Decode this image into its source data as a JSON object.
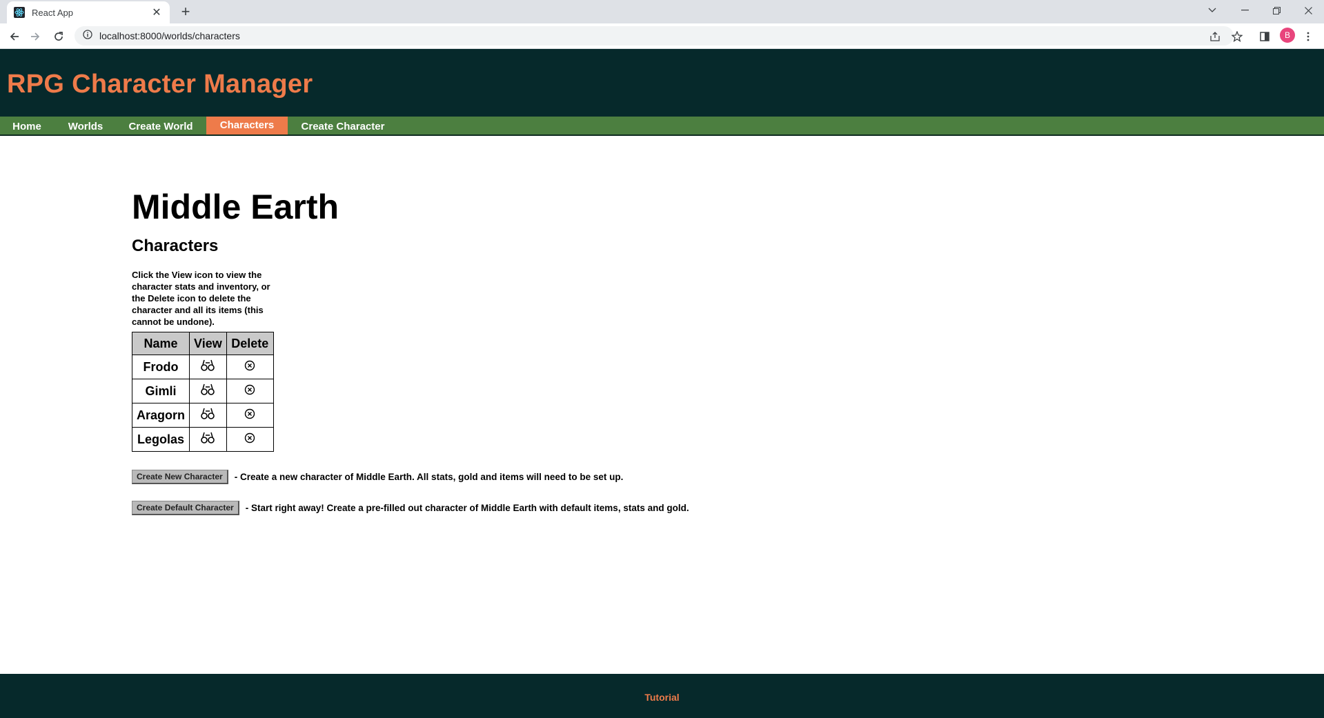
{
  "browser": {
    "tab_title": "React App",
    "tab_close": "✕",
    "new_tab": "+",
    "url": "localhost:8000/worlds/characters",
    "profile_initial": "B"
  },
  "app": {
    "title": "RPG Character Manager"
  },
  "nav": {
    "items": [
      {
        "label": "Home"
      },
      {
        "label": "Worlds"
      },
      {
        "label": "Create World"
      },
      {
        "label": "Characters",
        "active": true
      },
      {
        "label": "Create Character"
      }
    ]
  },
  "page": {
    "world_name": "Middle Earth",
    "section_title": "Characters",
    "instructions": "Click the View icon to view the character stats and inventory, or the Delete icon to delete the character and all its items (this cannot be undone).",
    "table": {
      "headers": [
        "Name",
        "View",
        "Delete"
      ],
      "rows": [
        {
          "name": "Frodo",
          "view_icon": "binoculars-icon",
          "delete_icon": "circle-x-icon"
        },
        {
          "name": "Gimli",
          "view_icon": "binoculars-icon",
          "delete_icon": "circle-x-icon"
        },
        {
          "name": "Aragorn",
          "view_icon": "binoculars-icon",
          "delete_icon": "circle-x-icon"
        },
        {
          "name": "Legolas",
          "view_icon": "binoculars-icon",
          "delete_icon": "circle-x-icon"
        }
      ]
    },
    "actions": [
      {
        "button": "Create New Character",
        "description": "- Create a new character of Middle Earth. All stats, gold and items will need to be set up."
      },
      {
        "button": "Create Default Character",
        "description": "- Start right away! Create a pre-filled out character of Middle Earth with default items, stats and gold."
      }
    ]
  },
  "footer": {
    "link": "Tutorial"
  },
  "colors": {
    "header_bg": "#06292b",
    "accent": "#ee7b4a",
    "nav_bg": "#4c7f40"
  }
}
